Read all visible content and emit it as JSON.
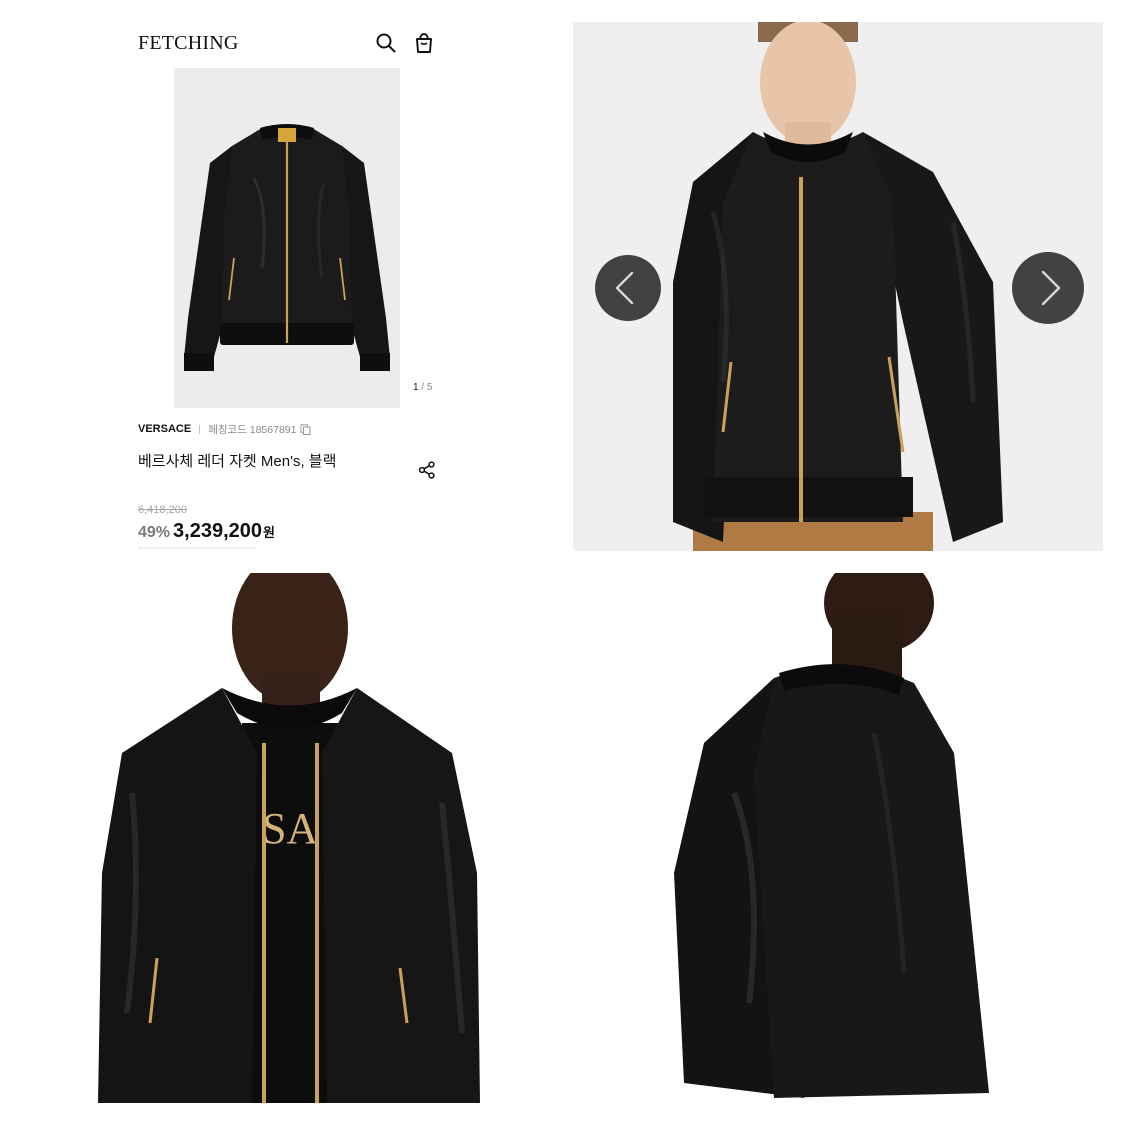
{
  "header": {
    "logo": "FETCHING",
    "search_icon": "search-icon",
    "cart_icon": "shopping-bag-icon"
  },
  "gallery": {
    "current": "1",
    "separator": "/",
    "total": "5"
  },
  "product": {
    "brand": "VERSACE",
    "code_label": "페칭코드 18567891",
    "name": "베르사체 레더 자켓 Men's, 블랙",
    "original_price": "6,418,200",
    "discount": "49%",
    "price": "3,239,200",
    "currency": "원"
  },
  "icons": {
    "copy": "copy-icon",
    "share": "share-icon",
    "prev": "chevron-left-icon",
    "next": "chevron-right-icon"
  },
  "colors": {
    "nav_button": "#424242",
    "jacket": "#121212",
    "zipper": "#c9a25a",
    "background": "#eeeeee"
  }
}
